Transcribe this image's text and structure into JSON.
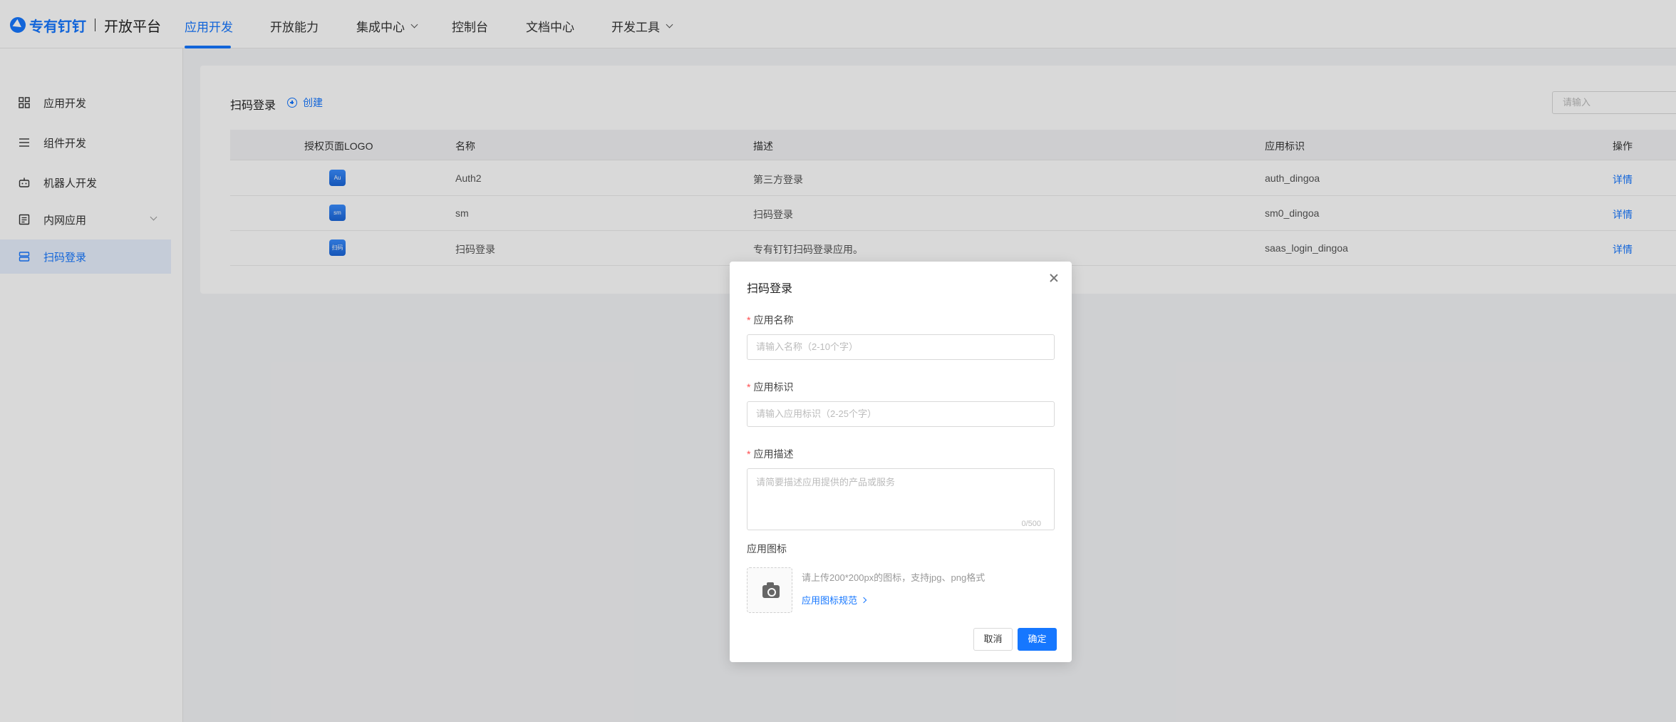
{
  "header": {
    "brand": "专有钉钉",
    "platform": "开放平台",
    "nav": [
      {
        "label": "应用开发",
        "active": true
      },
      {
        "label": "开放能力"
      },
      {
        "label": "集成中心",
        "dropdown": true
      },
      {
        "label": "控制台"
      },
      {
        "label": "文档中心"
      },
      {
        "label": "开发工具",
        "dropdown": true
      }
    ]
  },
  "sidebar": {
    "items": [
      {
        "label": "应用开发",
        "icon": "grid-icon"
      },
      {
        "label": "组件开发",
        "icon": "list-icon"
      },
      {
        "label": "机器人开发",
        "icon": "robot-icon"
      },
      {
        "label": "内网应用",
        "icon": "document-icon",
        "expandable": true
      },
      {
        "label": "扫码登录",
        "icon": "server-icon",
        "active": true
      }
    ]
  },
  "main": {
    "title": "扫码登录",
    "create_label": "创建",
    "search_placeholder": "请输入",
    "table": {
      "columns": [
        "授权页面LOGO",
        "名称",
        "描述",
        "应用标识",
        "操作"
      ],
      "rows": [
        {
          "logo": "Au",
          "name": "Auth2",
          "desc": "第三方登录",
          "id": "auth_dingoa",
          "action": "详情"
        },
        {
          "logo": "sm",
          "name": "sm",
          "desc": "扫码登录",
          "id": "sm0_dingoa",
          "action": "详情"
        },
        {
          "logo": "扫码",
          "name": "扫码登录",
          "desc": "专有钉钉扫码登录应用。",
          "id": "saas_login_dingoa",
          "action": "详情"
        }
      ]
    }
  },
  "modal": {
    "title": "扫码登录",
    "required_mark": "*",
    "fields": {
      "name_label": "应用名称",
      "name_placeholder": "请输入名称（2-10个字）",
      "id_label": "应用标识",
      "id_placeholder": "请输入应用标识（2-25个字）",
      "desc_label": "应用描述",
      "desc_placeholder": "请简要描述应用提供的产品或服务",
      "desc_counter": "0/500",
      "icon_label": "应用图标",
      "icon_hint": "请上传200*200px的图标，支持jpg、png格式",
      "icon_spec_link": "应用图标规范"
    },
    "cancel_label": "取消",
    "ok_label": "确定"
  },
  "colors": {
    "accent": "#1677ff",
    "required": "#ff4d4f"
  }
}
